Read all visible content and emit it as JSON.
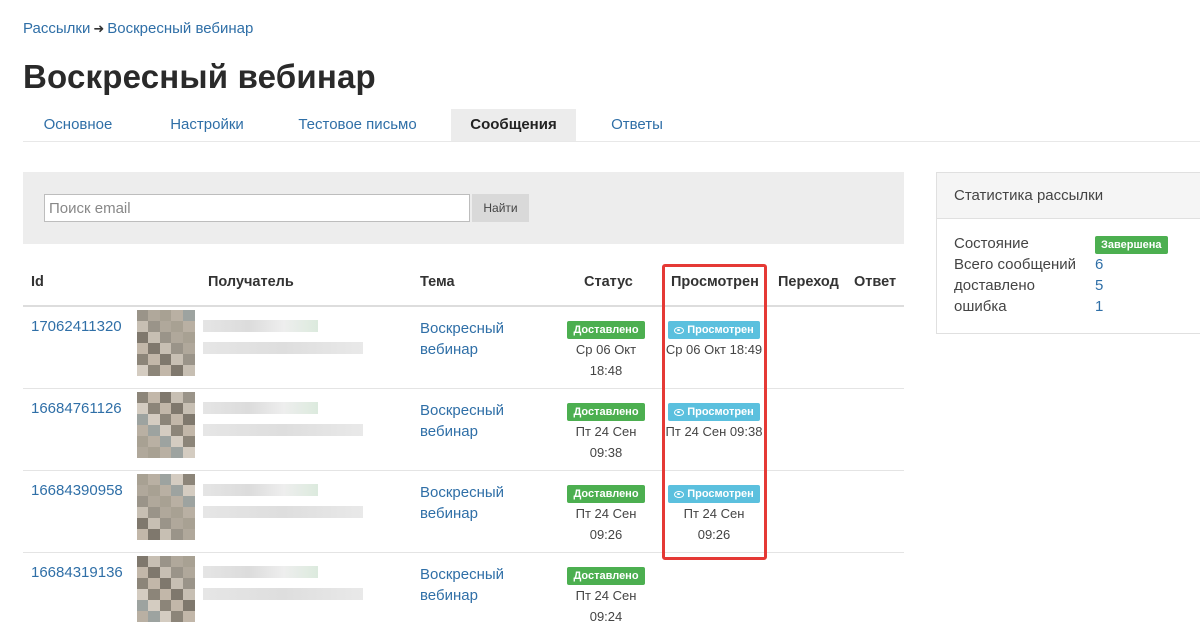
{
  "breadcrumb": {
    "parent": "Рассылки",
    "separator": "➜",
    "current": "Воскресный вебинар"
  },
  "title": "Воскресный вебинар",
  "tabs": [
    {
      "label": "Основное"
    },
    {
      "label": "Настройки"
    },
    {
      "label": "Тестовое письмо"
    },
    {
      "label": "Сообщения",
      "active": true
    },
    {
      "label": "Ответы"
    }
  ],
  "search": {
    "placeholder": "Поиск email",
    "button": "Найти"
  },
  "table": {
    "headers": {
      "id": "Id",
      "recipient": "Получатель",
      "topic": "Тема",
      "status": "Статус",
      "viewed": "Просмотрен",
      "click": "Переход",
      "reply": "Ответ"
    },
    "rows": [
      {
        "id": "17062411320",
        "topic": "Воскресный вебинар",
        "status": "Доставлено",
        "status_date": "Ср 06 Окт 18:48",
        "viewed": "Просмотрен",
        "viewed_date": "Ср 06 Окт 18:49"
      },
      {
        "id": "16684761126",
        "topic": "Воскресный вебинар",
        "status": "Доставлено",
        "status_date": "Пт 24 Сен 09:38",
        "viewed": "Просмотрен",
        "viewed_date": "Пт 24 Сен 09:38"
      },
      {
        "id": "16684390958",
        "topic": "Воскресный вебинар",
        "status": "Доставлено",
        "status_date": "Пт 24 Сен 09:26",
        "viewed": "Просмотрен",
        "viewed_date": "Пт 24 Сен 09:26"
      },
      {
        "id": "16684319136",
        "topic": "Воскресный вебинар",
        "status": "Доставлено",
        "status_date": "Пт 24 Сен 09:24",
        "viewed": "",
        "viewed_date": ""
      }
    ]
  },
  "stats": {
    "title": "Статистика рассылки",
    "state_label": "Состояние",
    "state_value": "Завершена",
    "total_label": "Всего сообщений",
    "total_value": "6",
    "delivered_label": "доставлено",
    "delivered_value": "5",
    "error_label": "ошибка",
    "error_value": "1"
  },
  "colors": {
    "link": "#2f6fa7",
    "delivered": "#4caf50",
    "viewed": "#5bc0de",
    "highlight": "#e53935"
  },
  "icons": {
    "viewed_badge": "eye-icon",
    "breadcrumb_separator": "arrow-right-icon"
  }
}
